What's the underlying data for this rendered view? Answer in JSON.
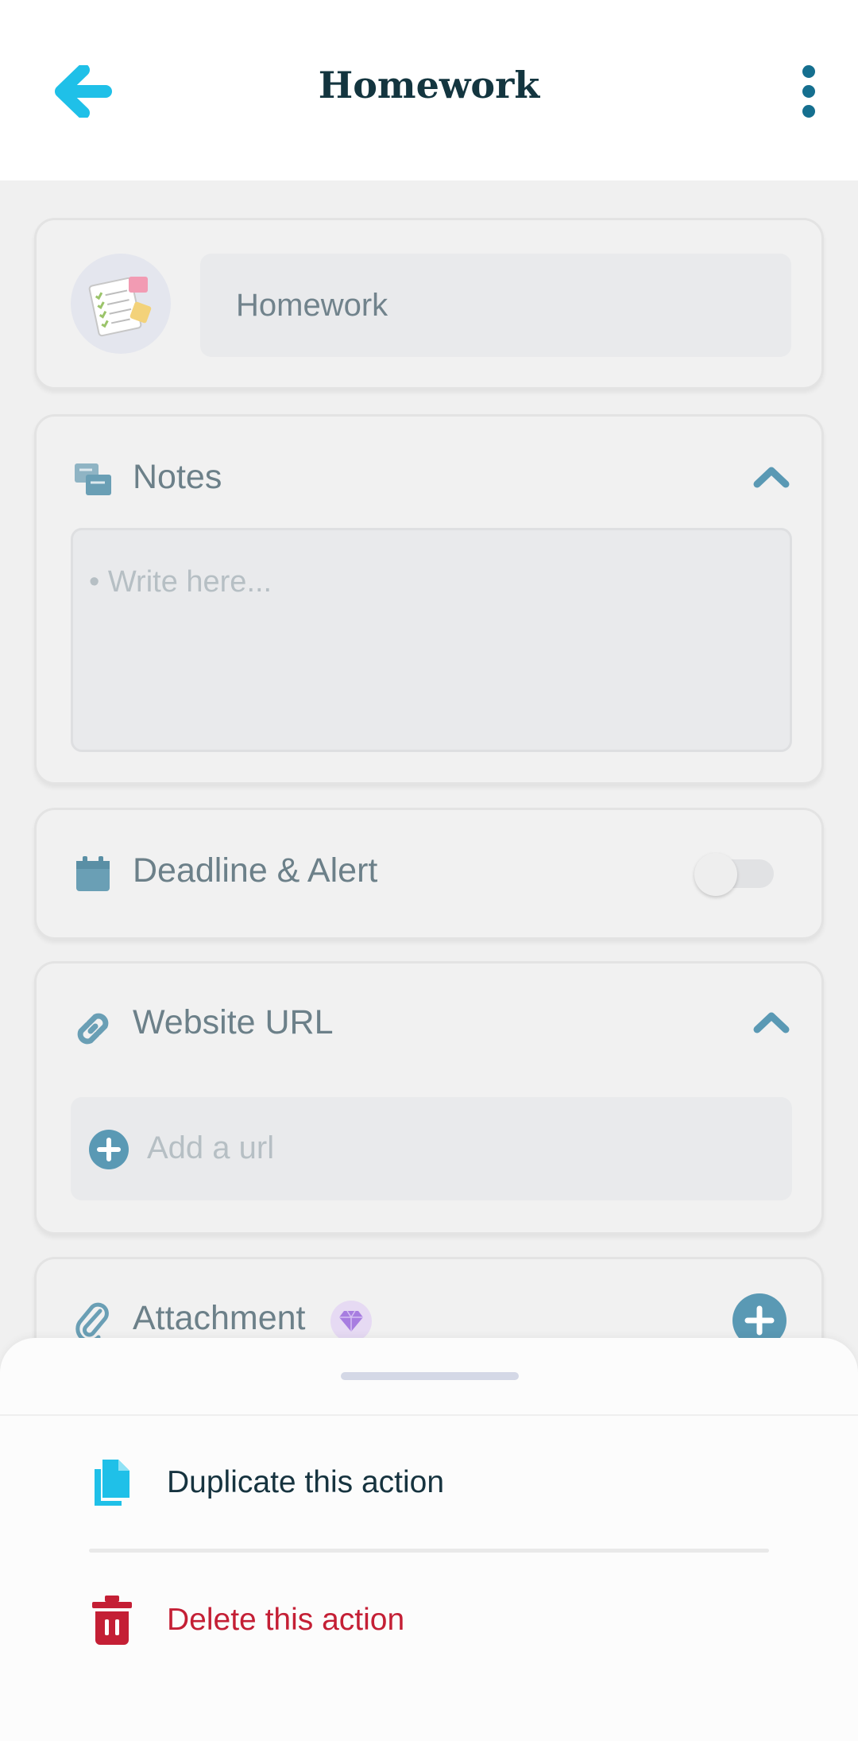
{
  "header": {
    "title": "Homework"
  },
  "name_card": {
    "name_value": "Homework"
  },
  "notes_card": {
    "label": "Notes",
    "placeholder": "• Write here..."
  },
  "deadline_card": {
    "label": "Deadline & Alert",
    "toggle_on": false
  },
  "url_card": {
    "label": "Website URL",
    "add_placeholder": "Add a url"
  },
  "attachment_card": {
    "label": "Attachment"
  },
  "bottom_sheet": {
    "duplicate_label": "Duplicate this action",
    "delete_label": "Delete this action"
  },
  "colors": {
    "accent_cyan": "#1fc0e8",
    "accent_teal": "#156f8f",
    "danger": "#c41f35",
    "icon_muted": "#6a9fb5"
  },
  "icons": {
    "back": "arrow-left-icon",
    "more": "more-vertical-icon",
    "notes": "sticky-notes-icon",
    "calendar": "calendar-icon",
    "link": "link-icon",
    "attach": "paperclip-icon",
    "gem": "premium-gem-icon",
    "duplicate": "duplicate-icon",
    "delete": "trash-icon"
  }
}
